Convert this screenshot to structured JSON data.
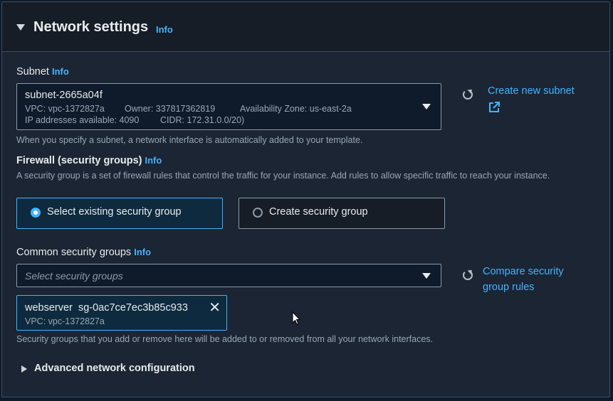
{
  "section": {
    "title": "Network settings",
    "info": "Info"
  },
  "subnet": {
    "label": "Subnet",
    "info": "Info",
    "selected_name": "subnet-2665a04f",
    "vpc": "VPC: vpc-1372827a",
    "owner": "Owner: 337817362819",
    "az": "Availability Zone: us-east-2a",
    "ips": "IP addresses available: 4090",
    "cidr": "CIDR: 172.31.0.0/20)",
    "create_link": "Create new subnet",
    "help": "When you specify a subnet, a network interface is automatically added to your template."
  },
  "firewall": {
    "label": "Firewall (security groups)",
    "info": "Info",
    "desc": "A security group is a set of firewall rules that control the traffic for your instance. Add rules to allow specific traffic to reach your instance.",
    "options": [
      {
        "label": "Select existing security group",
        "selected": true
      },
      {
        "label": "Create security group",
        "selected": false
      }
    ]
  },
  "common_sg": {
    "label": "Common security groups",
    "info": "Info",
    "placeholder": "Select security groups",
    "compare_link": "Compare security group rules",
    "token_name": "webserver",
    "token_id": "sg-0ac7ce7ec3b85c933",
    "token_vpc": "VPC: vpc-1372827a",
    "help": "Security groups that you add or remove here will be added to or removed from all your network interfaces."
  },
  "advanced": {
    "label": "Advanced network configuration"
  },
  "icons": {
    "refresh": "refresh-icon",
    "external": "external-link-icon",
    "remove": "close-icon",
    "caret": "caret-down-icon"
  }
}
